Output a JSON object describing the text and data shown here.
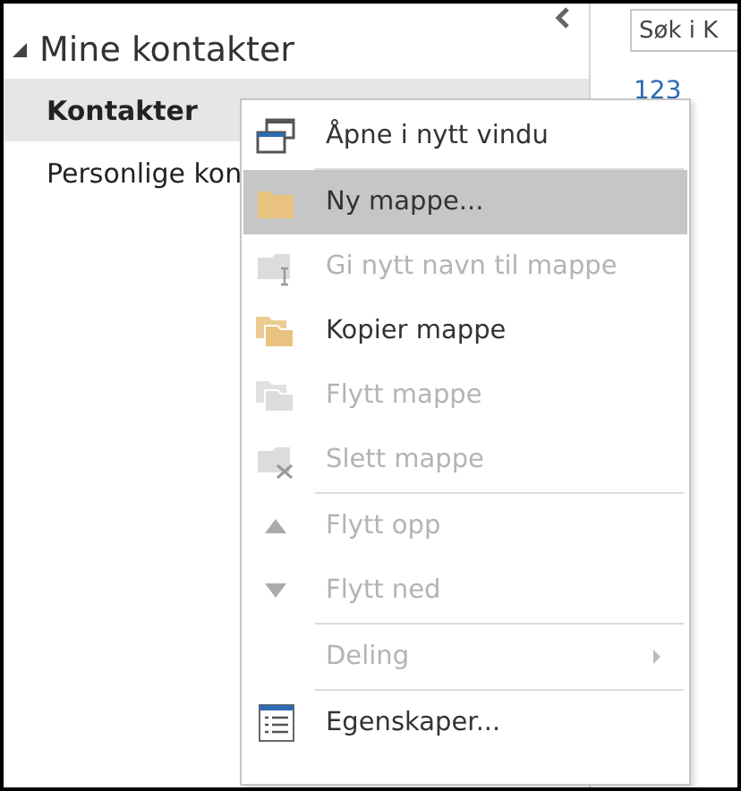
{
  "folder_pane": {
    "section": {
      "title": "Mine kontakter",
      "expanded": true
    },
    "folders": [
      {
        "name": "Kontakter",
        "selected": true
      },
      {
        "name": "Personlige kon",
        "selected": false
      }
    ]
  },
  "list_pane": {
    "search": {
      "placeholder": "Søk i K"
    },
    "index_label": "123"
  },
  "context_menu": {
    "items": [
      {
        "label": "Åpne i nytt vindu",
        "kind": "window",
        "disabled": false,
        "selected": false,
        "divider_above": false,
        "submenu": false
      },
      {
        "label": "Ny mappe...",
        "kind": "folder",
        "disabled": false,
        "selected": true,
        "divider_above": true,
        "submenu": false
      },
      {
        "label": "Gi nytt navn til mappe",
        "kind": "rename",
        "disabled": true,
        "selected": false,
        "divider_above": false,
        "submenu": false
      },
      {
        "label": "Kopier mappe",
        "kind": "copy",
        "disabled": false,
        "selected": false,
        "divider_above": false,
        "submenu": false
      },
      {
        "label": "Flytt mappe",
        "kind": "copy",
        "disabled": true,
        "selected": false,
        "divider_above": false,
        "submenu": false
      },
      {
        "label": "Slett mappe",
        "kind": "delete",
        "disabled": true,
        "selected": false,
        "divider_above": false,
        "submenu": false
      },
      {
        "label": "Flytt opp",
        "kind": "up",
        "disabled": true,
        "selected": false,
        "divider_above": true,
        "submenu": false
      },
      {
        "label": "Flytt ned",
        "kind": "down",
        "disabled": true,
        "selected": false,
        "divider_above": false,
        "submenu": false
      },
      {
        "label": "Deling",
        "kind": "plain",
        "disabled": true,
        "selected": false,
        "divider_above": true,
        "submenu": true
      },
      {
        "label": "Egenskaper...",
        "kind": "properties",
        "disabled": false,
        "selected": false,
        "divider_above": true,
        "submenu": false
      }
    ]
  }
}
